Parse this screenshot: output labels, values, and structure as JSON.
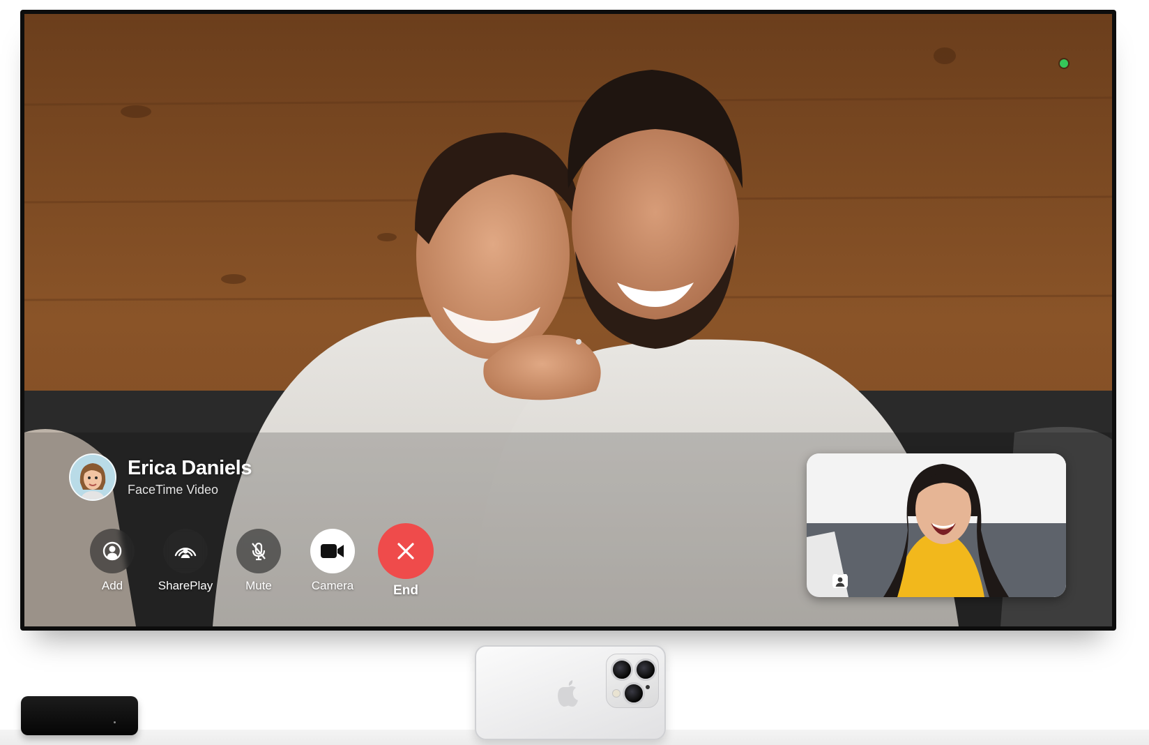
{
  "call": {
    "caller_name": "Erica Daniels",
    "call_type": "FaceTime Video",
    "status_indicator_color": "#35c759"
  },
  "controls": [
    {
      "id": "add",
      "label": "Add",
      "icon": "person-circle-icon"
    },
    {
      "id": "shareplay",
      "label": "SharePlay",
      "icon": "shareplay-icon"
    },
    {
      "id": "mute",
      "label": "Mute",
      "icon": "mic-slash-icon"
    },
    {
      "id": "camera",
      "label": "Camera",
      "icon": "video-camera-icon"
    },
    {
      "id": "end",
      "label": "End",
      "icon": "close-icon"
    }
  ],
  "self_view": {
    "icons": [
      "center-stage-icon",
      "portrait-mode-icon"
    ]
  },
  "colors": {
    "end_button": "#ef4b4b",
    "camera_button": "#ffffff",
    "control_button": "#282828"
  }
}
